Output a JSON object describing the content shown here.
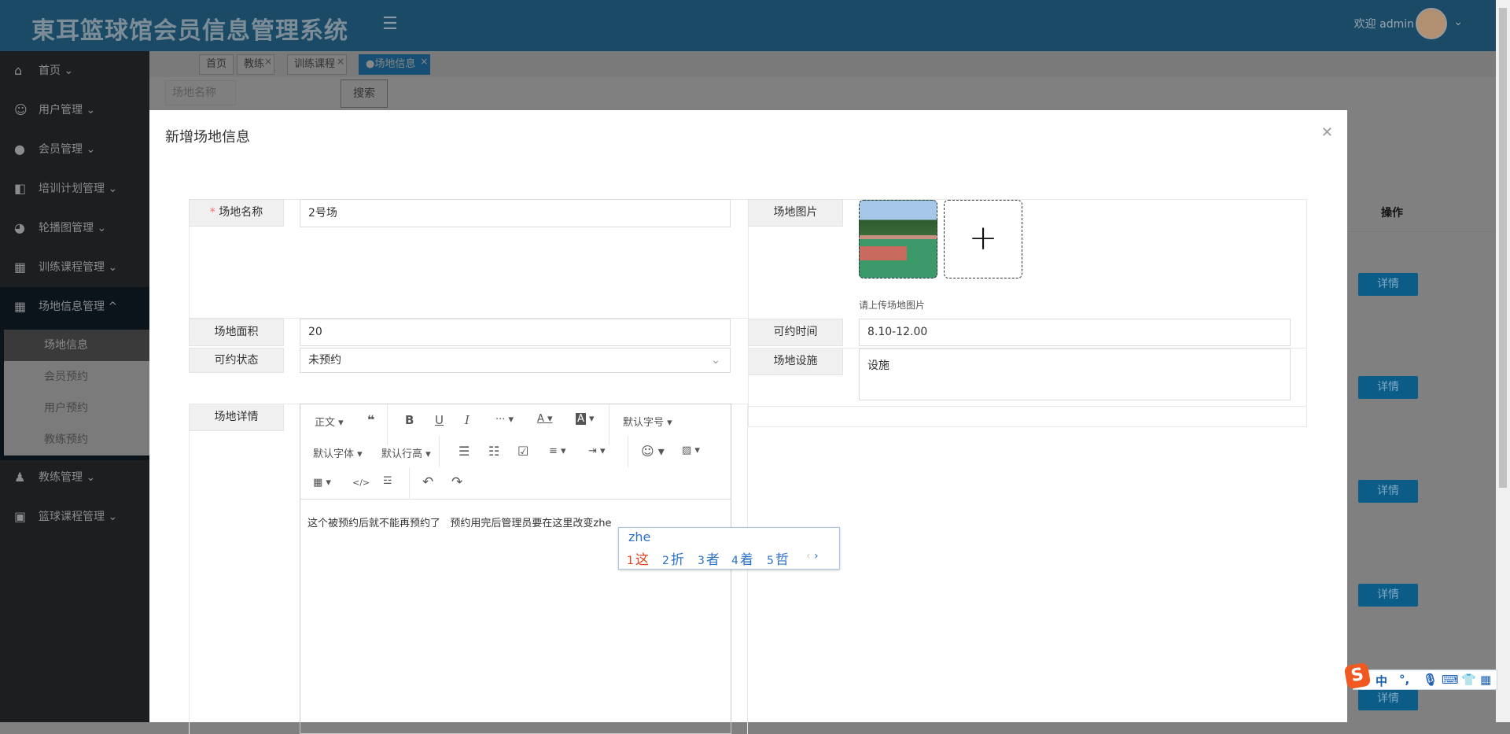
{
  "header": {
    "title": "東耳篮球馆会员信息管理系统",
    "welcome": "欢迎 admin",
    "menu_icon": "menu-fold-icon"
  },
  "sidebar": {
    "items": [
      {
        "label": "首页",
        "icon": "home-icon"
      },
      {
        "label": "用户管理",
        "icon": "user-circle-icon"
      },
      {
        "label": "会员管理",
        "icon": "member-icon"
      },
      {
        "label": "培训计划管理",
        "icon": "book-icon"
      },
      {
        "label": "轮播图管理",
        "icon": "dashboard-icon"
      },
      {
        "label": "训练课程管理",
        "icon": "grid-icon"
      },
      {
        "label": "场地信息管理",
        "icon": "grid-icon"
      },
      {
        "label": "教练管理",
        "icon": "person-icon"
      },
      {
        "label": "篮球课程管理",
        "icon": "picture-icon"
      }
    ],
    "submenu": [
      "场地信息",
      "会员预约",
      "用户预约",
      "教练预约"
    ]
  },
  "tabs": [
    {
      "label": "首页"
    },
    {
      "label": "教练"
    },
    {
      "label": "训练课程"
    },
    {
      "label": "●场地信息"
    }
  ],
  "search": {
    "placeholder": "场地名称",
    "button": "搜索"
  },
  "table": {
    "ops_header": "操作",
    "detail_label": "详情"
  },
  "modal": {
    "title": "新增场地信息",
    "fields": {
      "name_label": "场地名称",
      "name_value": "2号场",
      "image_label": "场地图片",
      "image_hint": "请上传场地图片",
      "area_label": "场地面积",
      "area_value": "20",
      "time_label": "可约时间",
      "time_value": "8.10-12.00",
      "status_label": "可约状态",
      "status_value": "未预约",
      "facility_label": "场地设施",
      "facility_value": "设施",
      "detail_label": "场地详情"
    },
    "editor": {
      "toolbar": [
        "正文",
        "默认字号",
        "默认字体",
        "默认行高"
      ],
      "content": "这个被预约后就不能再预约了   预约用完后管理员要在这里改变zhe"
    }
  },
  "ime": {
    "pinyin": "zhe",
    "candidates": [
      "这",
      "折",
      "者",
      "着",
      "哲"
    ],
    "toolbar": [
      "中",
      "°,"
    ]
  }
}
